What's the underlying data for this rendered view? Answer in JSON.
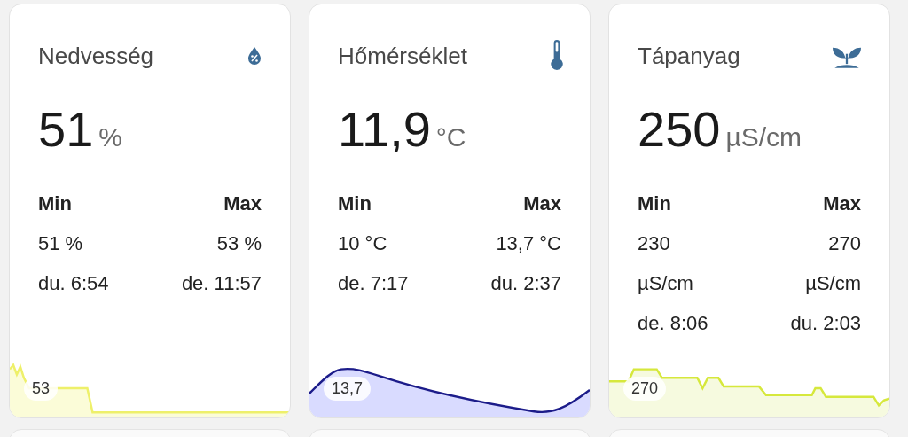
{
  "cards": [
    {
      "kind": "humidity",
      "title": "Nedvesség",
      "value": "51",
      "unit": "%",
      "min": {
        "label": "Min",
        "lines": [
          "51 %",
          "du. 6:54"
        ]
      },
      "max": {
        "label": "Max",
        "lines": [
          "53 %",
          "de. 11:57"
        ]
      },
      "graph": {
        "kind": "step",
        "color": "#eef06a",
        "label": "53"
      }
    },
    {
      "kind": "temperature",
      "title": "Hőmérséklet",
      "value": "11,9",
      "unit": "°C",
      "min": {
        "label": "Min",
        "lines": [
          "10 °C",
          "de. 7:17"
        ]
      },
      "max": {
        "label": "Max",
        "lines": [
          "13,7 °C",
          "du. 2:37"
        ]
      },
      "graph": {
        "kind": "smooth",
        "color": "#1c1c8a",
        "label": "13,7"
      }
    },
    {
      "kind": "nutrient",
      "title": "Tápanyag",
      "value": "250",
      "unit": "µS/cm",
      "min": {
        "label": "Min",
        "lines": [
          "230",
          "µS/cm",
          "de. 8:06"
        ]
      },
      "max": {
        "label": "Max",
        "lines": [
          "270",
          "µS/cm",
          "du. 2:03"
        ]
      },
      "graph": {
        "kind": "noisy",
        "color": "#d6e83c",
        "label": "270"
      }
    }
  ]
}
